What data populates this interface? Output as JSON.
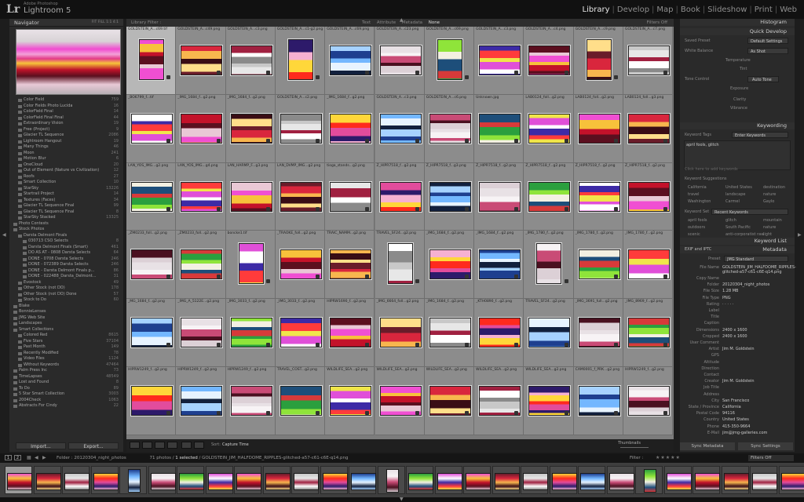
{
  "app": {
    "adobe_line": "Adobe Photoshop",
    "title": "Lightroom 5",
    "logo": "Lr"
  },
  "modules": [
    "Library",
    "Develop",
    "Map",
    "Book",
    "Slideshow",
    "Print",
    "Web"
  ],
  "active_module": "Library",
  "left_panel": {
    "navigator_title": "Navigator",
    "navigator_zoom_options": [
      "FIT",
      "FILL",
      "1:1",
      "4:1"
    ],
    "collections": [
      {
        "name": "Color Field",
        "count": "759",
        "indent": 2
      },
      {
        "name": "Color Fields Photo Lucida",
        "count": "16",
        "indent": 2
      },
      {
        "name": "ColorField Final",
        "count": "14",
        "indent": 2
      },
      {
        "name": "ColorField Final Final",
        "count": "44",
        "indent": 2
      },
      {
        "name": "Extraordinary Vision",
        "count": "19",
        "indent": 2
      },
      {
        "name": "Free (Project)",
        "count": "9",
        "indent": 2
      },
      {
        "name": "Glacier TL Sequence",
        "count": "2086",
        "indent": 2
      },
      {
        "name": "Lightroom Hangout",
        "count": "19",
        "indent": 2
      },
      {
        "name": "Many Things",
        "count": "46",
        "indent": 2
      },
      {
        "name": "Moon",
        "count": "241",
        "indent": 2
      },
      {
        "name": "Motion Blur",
        "count": "6",
        "indent": 2
      },
      {
        "name": "OneCloud",
        "count": "20",
        "indent": 2
      },
      {
        "name": "Out of Element (Nature vs Civilization)",
        "count": "12",
        "indent": 2
      },
      {
        "name": "Roofs",
        "count": "27",
        "indent": 2
      },
      {
        "name": "Smart Collection",
        "count": "10",
        "indent": 2
      },
      {
        "name": "StarSky",
        "count": "13226",
        "indent": 2
      },
      {
        "name": "Startrail Project",
        "count": "14",
        "indent": 2
      },
      {
        "name": "Textures (Faces)",
        "count": "34",
        "indent": 2
      },
      {
        "name": "Glacier TL Sequence Final",
        "count": "99",
        "indent": 2
      },
      {
        "name": "Glacier TL Sequence Final",
        "count": "8",
        "indent": 2
      },
      {
        "name": "StarSky Stacked",
        "count": "13325",
        "indent": 2
      },
      {
        "name": "Photo Contests",
        "count": "",
        "indent": 1
      },
      {
        "name": "Stock Photos",
        "count": "",
        "indent": 1
      },
      {
        "name": "Darsta Delmont Finals",
        "count": "",
        "indent": 2
      },
      {
        "name": "030713 CSO Selects",
        "count": "8",
        "indent": 3
      },
      {
        "name": "Darsta Delmont Finals (Smart)",
        "count": "461",
        "indent": 3
      },
      {
        "name": "DO AS AT - 0808 Darsta Selects",
        "count": "64",
        "indent": 3
      },
      {
        "name": "DONE - 0708 Darsta Selects",
        "count": "246",
        "indent": 3
      },
      {
        "name": "DONE - 072389 Darsta Selects",
        "count": "246",
        "indent": 3
      },
      {
        "name": "DONE - Darsta Delmont Finals p...",
        "count": "86",
        "indent": 3
      },
      {
        "name": "DONE - 022488_Darsta_Delmont...",
        "count": "31",
        "indent": 3
      },
      {
        "name": "Evostock",
        "count": "49",
        "indent": 2
      },
      {
        "name": "Other Stock (not DO)",
        "count": "178",
        "indent": 2
      },
      {
        "name": "Other Stock (not DO) Done",
        "count": "57",
        "indent": 2
      },
      {
        "name": "Stock to Do",
        "count": "60",
        "indent": 2
      },
      {
        "name": "Blake",
        "count": "",
        "indent": 1
      },
      {
        "name": "BonnieLenses",
        "count": "",
        "indent": 1
      },
      {
        "name": "JMG Web Site",
        "count": "",
        "indent": 1
      },
      {
        "name": "Landscapes",
        "count": "",
        "indent": 1
      },
      {
        "name": "Smart Collections",
        "count": "",
        "indent": 1
      },
      {
        "name": "Colored Red",
        "count": "8615",
        "indent": 2
      },
      {
        "name": "Five Stars",
        "count": "37104",
        "indent": 2
      },
      {
        "name": "Past Month",
        "count": "149",
        "indent": 2
      },
      {
        "name": "Recently Modified",
        "count": "78",
        "indent": 2
      },
      {
        "name": "Video Files",
        "count": "1124",
        "indent": 2
      },
      {
        "name": "Without Keywords",
        "count": "47464",
        "indent": 2
      },
      {
        "name": "Palm Press Inc",
        "count": "73",
        "indent": 1
      },
      {
        "name": "TimeLapses",
        "count": "48549",
        "indent": 1
      },
      {
        "name": "Lost and Found",
        "count": "8",
        "indent": 1
      },
      {
        "name": "To Do",
        "count": "89",
        "indent": 1
      },
      {
        "name": "5 Star Smart Collection",
        "count": "3003",
        "indent": 1
      },
      {
        "name": "2004Check",
        "count": "1063",
        "indent": 1
      },
      {
        "name": "Abstracts For Cindy",
        "count": "22",
        "indent": 1
      }
    ],
    "import_label": "Import...",
    "export_label": "Export..."
  },
  "filter_bar": {
    "label": "Library Filter :",
    "options": [
      "Text",
      "Attribute",
      "Metadata",
      "None"
    ],
    "active": "None",
    "filters_off": "Filters Off"
  },
  "grid": {
    "rows": [
      [
        "GOLDSTEIN_A...c69.tif",
        "GOLDSTEIN_A...c49.png",
        "GOLDSTEIN_A...c3.png",
        "GOLDSTEIN_A...c1-g2.png",
        "GOLDSTEIN_A...c69.png",
        "GOLDSTEIN_A...c23.png",
        "GOLDSTEIN_A...c69.png",
        "GOLDSTEIN_A...c3.png",
        "GOLDSTEIN_A...c4.png",
        "GOLDSTEIN_A...c9.png",
        "GOLDSTEIN_A...c7.png"
      ],
      [
        "_BO6799_f...tif",
        "_IMG_1684_f...g2.png",
        "_IMG_1684_f...g2.png",
        "GOLDSTEIN_A...c2.png",
        "_IMG_1684_f...g2.png",
        "GOLDSTEIN_A...c3.png",
        "GOLDSTEIN_A...c6.png",
        "Unknown.jpg",
        "LAB0124_foll...g2.png",
        "LAB0124_foll...g2.png",
        "LAB0124_foll...g3.png"
      ],
      [
        "LAN_YOS_IMG...g2.png",
        "LAN_YOS_IMG...g4.png",
        "LAN_HARMP_F...g3.png",
        "LAN_DVMP_IMG...g2.png",
        "tioga_stands...g2.png",
        "Z_HIPR7518_f...g2.png",
        "Z_HIPR7518_f...g3.png",
        "Z_HIPR7518_f...g2.png",
        "Z_HIPR7518_f...g2.png",
        "Z_HIPR7518_f...g2.png",
        "Z_HIPR7518_f...g2.png"
      ],
      [
        "_ZM0233_foll...g2.png",
        "_ZM0233_foll...g2.png",
        "boncke1.tif",
        "_TRAOKE_foll...g2.png",
        "TRAIC_NAMM...g2.png",
        "TRAVEL_SF24...g2.png",
        "_IMG_1684_f...g2.png",
        "_IMG_1684_f...g2.png",
        "_IMG_1780_f...g2.png",
        "_IMG_1780_f...g2.png",
        "_IMG_1780_f...g2.png"
      ],
      [
        "_MG_1684_f...g2.png",
        "_IMG_A_5122E...g2.png",
        "_IMG_3033_f...g2.png",
        "_IMG_3033_f...g2.png",
        "HIPRW1690_f...g2.png",
        "_IMG_6664_foll...g2.png",
        "_IMG_1684_f...g2.png",
        "_KTH0890_f...g2.png",
        "TRAVEL_SF24...g2.png",
        "_IMG_3691_full...g2.png",
        "_IMG_8969_f...g2.png"
      ],
      [
        "HIPRW1249_f...g2.png",
        "HIPRW1249_f...g2.png",
        "HIPRW1249_f...g2.png",
        "TRAVEL_COST...g2.png",
        "WILDLIFE_SEA...g2.png",
        "WILDLIFE_SEA...g2.png",
        "WILDLIFE_SEA...g2.png",
        "WILDLIFE_SEA...g2.png",
        "WILDLIFE_SEA...g2.png",
        "CAM0001_f_PRK...g2.png",
        "HIPRW1249_f...g2.png"
      ]
    ]
  },
  "right_panel": {
    "histogram": "Histogram",
    "quick_develop": "Quick Develop",
    "saved_preset_label": "Saved Preset",
    "saved_preset_value": "Default Settings",
    "white_balance_label": "White Balance",
    "white_balance_value": "As Shot",
    "temperature": "Temperature",
    "tint": "Tint",
    "tone_control": "Tone Control",
    "auto_tone": "Auto Tone",
    "exposure": "Exposure",
    "clarity": "Clarity",
    "vibrance": "Vibrance",
    "keywording": "Keywording",
    "keyword_tags_label": "Keyword Tags",
    "keyword_tags_value": "Enter Keywords",
    "keywords_text": "april fools, glitch",
    "click_to_add": "Click here to add keywords",
    "keyword_suggestions": "Keyword Suggestions",
    "suggestions": [
      "California",
      "United States",
      "destination",
      "travel",
      "landscape",
      "nature",
      "Washington",
      "Carmel",
      "Gaylo"
    ],
    "keyword_set_label": "Keyword Set",
    "keyword_set_value": "Recent Keywords",
    "recent": [
      "april fools",
      "glitch",
      "mountain",
      "outdoors",
      "South Pacific",
      "nature",
      "scenic",
      "anti-corporatist raw",
      "light"
    ],
    "keyword_list": "Keyword List",
    "metadata": "Metadata",
    "exif_iptc": "EXIF and IPTC",
    "preset_label": "Preset",
    "preset_value": "JMG Standard",
    "meta_fields": [
      {
        "label": "File Name",
        "value": "GOLDSTEIN_JIM_HALFDOME_RIPPLES-glitched-a57-c61-c6E-q14.png"
      },
      {
        "label": "Copy Name",
        "value": ""
      },
      {
        "label": "Folder",
        "value": "20120304_night_photos"
      },
      {
        "label": "File Size",
        "value": "1.28 MB"
      },
      {
        "label": "File Type",
        "value": "PNG"
      },
      {
        "label": "Rating",
        "value": "· · · · ·"
      },
      {
        "label": "Label",
        "value": ""
      },
      {
        "label": "Title",
        "value": ""
      },
      {
        "label": "Caption",
        "value": ""
      },
      {
        "label": "Dimensions",
        "value": "2400 x 1600"
      },
      {
        "label": "Cropped",
        "value": "2400 x 1600"
      },
      {
        "label": "User Comment",
        "value": ""
      },
      {
        "label": "Artist",
        "value": "Jim M. Goldstein"
      },
      {
        "label": "GPS",
        "value": ""
      },
      {
        "label": "Altitude",
        "value": ""
      },
      {
        "label": "Direction",
        "value": ""
      },
      {
        "label": "Contact",
        "value": ""
      },
      {
        "label": "Creator",
        "value": "Jim M. Goldstein"
      },
      {
        "label": "Job Title",
        "value": ""
      },
      {
        "label": "Address",
        "value": ""
      },
      {
        "label": "City",
        "value": "San Francisco"
      },
      {
        "label": "State / Province",
        "value": "California"
      },
      {
        "label": "Postal Code",
        "value": "94116"
      },
      {
        "label": "Country",
        "value": "United States"
      },
      {
        "label": "Phone",
        "value": "415-350-9664"
      },
      {
        "label": "E-Mail",
        "value": "jim@jmg-galleries.com"
      }
    ],
    "sync_metadata": "Sync Metadata",
    "sync_settings": "Sync Settings"
  },
  "toolbar": {
    "sort_label": "Sort:",
    "sort_value": "Capture Time",
    "thumbnails_label": "Thumbnails"
  },
  "filmstrip_bar": {
    "pages": [
      "1",
      "2"
    ],
    "folder_label": "Folder : 20120304_night_photos",
    "count_text": "71 photos /",
    "selected_text": "1 selected",
    "file_text": "/ GOLDSTEIN_JIM_HALFDOME_RIPPLES-glitched-a57-c61-c6E-q14.png",
    "filter_label": "Filter :",
    "filters_off": "Filters Off"
  },
  "colors": {
    "background": "#1d1d1d",
    "grid_bg": "#7c7c7c",
    "active_text": "#e6e6e6"
  }
}
